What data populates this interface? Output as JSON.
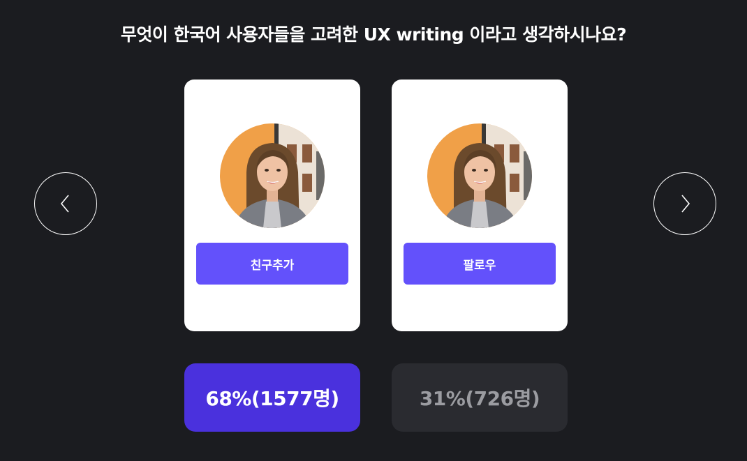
{
  "question": "무엇이 한국어 사용자들을 고려한 UX writing 이라고 생각하시나요?",
  "navigation": {
    "prev_icon": "chevron-left-icon",
    "next_icon": "chevron-right-icon"
  },
  "options": [
    {
      "button_label": "친구추가",
      "result_label": "68%(1577명)",
      "percent": 68,
      "votes": 1577,
      "selected": true
    },
    {
      "button_label": "팔로우",
      "result_label": "31%(726명)",
      "percent": 31,
      "votes": 726,
      "selected": false
    }
  ],
  "colors": {
    "background": "#1b1c20",
    "accent": "#6351fb",
    "result_selected": "#4a31dd",
    "result_unselected": "#2a2b30"
  }
}
